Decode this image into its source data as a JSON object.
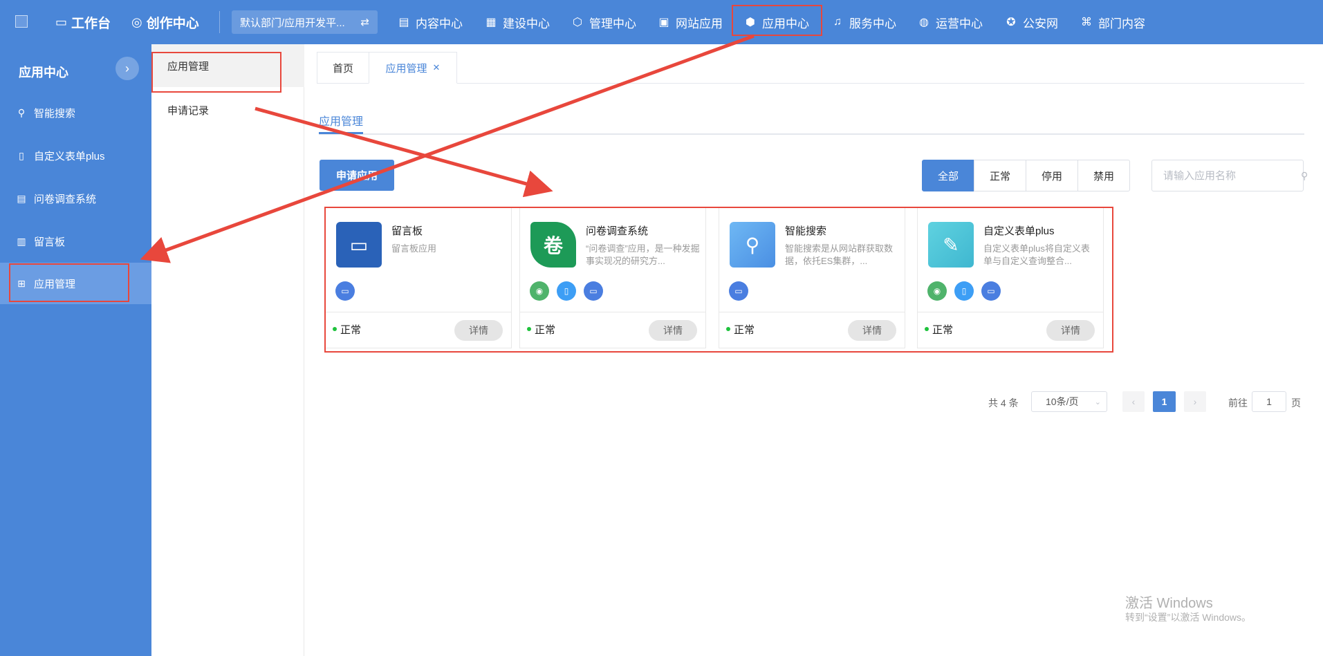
{
  "topbar": {
    "brand": [
      {
        "label": "工作台",
        "icon": "monitor-icon"
      },
      {
        "label": "创作中心",
        "icon": "lightbulb-icon"
      }
    ],
    "department": "默认部门/应用开发平...",
    "nav": [
      {
        "label": "内容中心",
        "icon": "document-icon"
      },
      {
        "label": "建设中心",
        "icon": "layout-icon"
      },
      {
        "label": "管理中心",
        "icon": "hexagon-icon"
      },
      {
        "label": "网站应用",
        "icon": "web-icon"
      },
      {
        "label": "应用中心",
        "icon": "cube-icon",
        "active": true
      },
      {
        "label": "服务中心",
        "icon": "headset-icon"
      },
      {
        "label": "运营中心",
        "icon": "chart-icon"
      },
      {
        "label": "公安网",
        "icon": "badge-icon"
      },
      {
        "label": "部门内容",
        "icon": "dept-icon"
      }
    ]
  },
  "sidebar": {
    "title": "应用中心",
    "items": [
      {
        "label": "智能搜索",
        "icon": "search-icon"
      },
      {
        "label": "自定义表单plus",
        "icon": "form-icon"
      },
      {
        "label": "问卷调查系统",
        "icon": "survey-icon"
      },
      {
        "label": "留言板",
        "icon": "calendar-icon"
      },
      {
        "label": "应用管理",
        "icon": "grid-icon",
        "active": true
      }
    ]
  },
  "submenu": {
    "items": [
      {
        "label": "应用管理",
        "active": true
      },
      {
        "label": "申请记录"
      }
    ]
  },
  "tabs": [
    {
      "label": "首页"
    },
    {
      "label": "应用管理",
      "closable": true,
      "active": true
    }
  ],
  "page": {
    "section_tab": "应用管理",
    "apply_button": "申请应用",
    "filters": [
      "全部",
      "正常",
      "停用",
      "禁用"
    ],
    "search_placeholder": "请输入应用名称"
  },
  "cards": [
    {
      "name": "留言板",
      "desc": "留言板应用",
      "status": "正常",
      "detail": "详情",
      "platforms": [
        "pc"
      ],
      "color": "#2a62b8"
    },
    {
      "name": "问卷调查系统",
      "desc": "“问卷调查”应用，是一种发掘事实现况的研究方...",
      "status": "正常",
      "detail": "详情",
      "platforms": [
        "wechat",
        "mobile",
        "pc"
      ],
      "color": "#1d9a57",
      "glyph": "卷"
    },
    {
      "name": "智能搜索",
      "desc": "智能搜索是从网站群获取数据，依托ES集群，...",
      "status": "正常",
      "detail": "详情",
      "platforms": [
        "pc"
      ],
      "color": "#5aa6ee"
    },
    {
      "name": "自定义表单plus",
      "desc": "自定义表单plus将自定义表单与自定义查询整合...",
      "status": "正常",
      "detail": "详情",
      "platforms": [
        "wechat",
        "mobile",
        "pc"
      ],
      "color": "#4fc2d8"
    }
  ],
  "pagination": {
    "total": "共 4 条",
    "page_size": "10条/页",
    "current": "1",
    "goto_label": "前往",
    "goto_value": "1",
    "page_suffix": "页"
  },
  "watermark": {
    "line1": "激活 Windows",
    "line2": "转到“设置”以激活 Windows。"
  },
  "colors": {
    "primary": "#4a86d8",
    "annotation": "#e8473c",
    "status_ok": "#1ec23c"
  }
}
